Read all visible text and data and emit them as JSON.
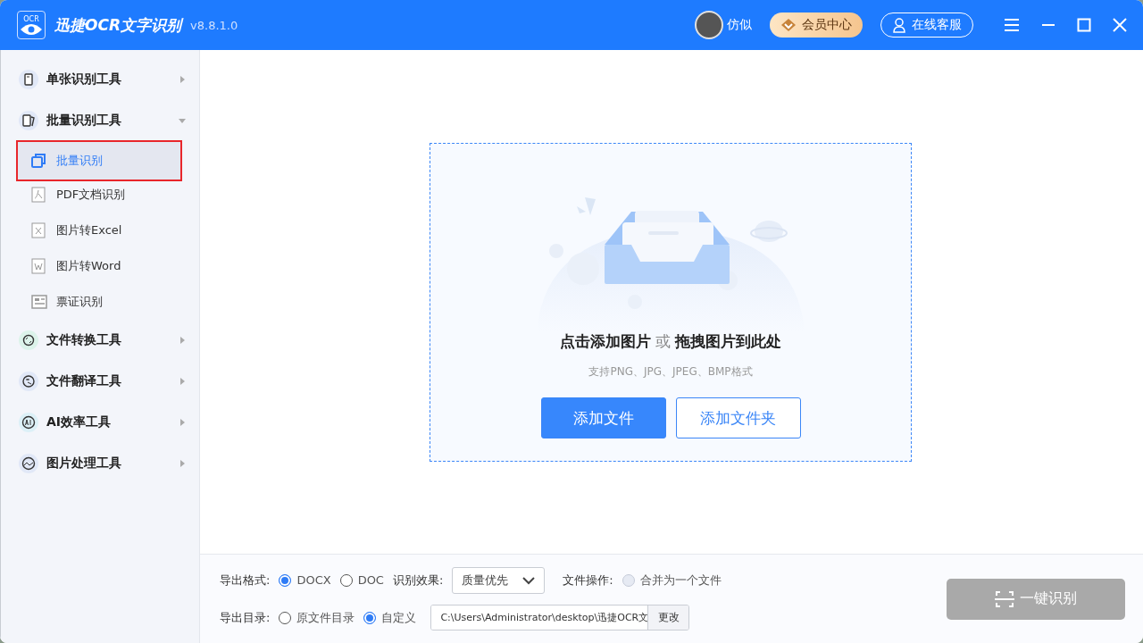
{
  "app": {
    "logo_text": "OCR",
    "title": "迅捷OCR文字识别",
    "version": "v8.8.1.0"
  },
  "header": {
    "user_name": "仿似",
    "vip_button": "会员中心",
    "service_button": "在线客服"
  },
  "sidebar": [
    {
      "label": "单张识别工具",
      "expanded": false
    },
    {
      "label": "批量识别工具",
      "expanded": true,
      "children": [
        {
          "label": "批量识别",
          "selected": true
        },
        {
          "label": "PDF文档识别",
          "selected": false
        },
        {
          "label": "图片转Excel",
          "selected": false
        },
        {
          "label": "图片转Word",
          "selected": false
        },
        {
          "label": "票证识别",
          "selected": false
        }
      ]
    },
    {
      "label": "文件转换工具",
      "expanded": false
    },
    {
      "label": "文件翻译工具",
      "expanded": false
    },
    {
      "label": "AI效率工具",
      "expanded": false
    },
    {
      "label": "图片处理工具",
      "expanded": false
    }
  ],
  "dropzone": {
    "heading": "**点击添加图片** 或 **拖拽图片到此处**",
    "hint": "支持PNG、JPG、JPEG、BMP格式",
    "buttons": [
      {
        "label": "添加文件",
        "primary": true
      },
      {
        "label": "添加文件夹",
        "primary": false
      }
    ]
  },
  "options": {
    "format_label": "导出格式:",
    "formats": [
      {
        "label": "DOCX",
        "selected": true
      },
      {
        "label": "DOC",
        "selected": false
      }
    ],
    "quality_label": "识别效果:",
    "quality_value": "质量优先",
    "file_op_label": "文件操作:",
    "merge": {
      "label": "合并为一个文件",
      "checked": false,
      "disabled": true
    },
    "dir_label": "导出目录:",
    "dirs": [
      {
        "label": "原文件目录",
        "selected": false
      },
      {
        "label": "自定义",
        "selected": true
      }
    ],
    "path": "C:\\Users\\Administrator\\desktop\\迅捷OCR文",
    "change_button": "更改"
  },
  "recognize_button": {
    "label": "一键识别",
    "disabled": true
  }
}
